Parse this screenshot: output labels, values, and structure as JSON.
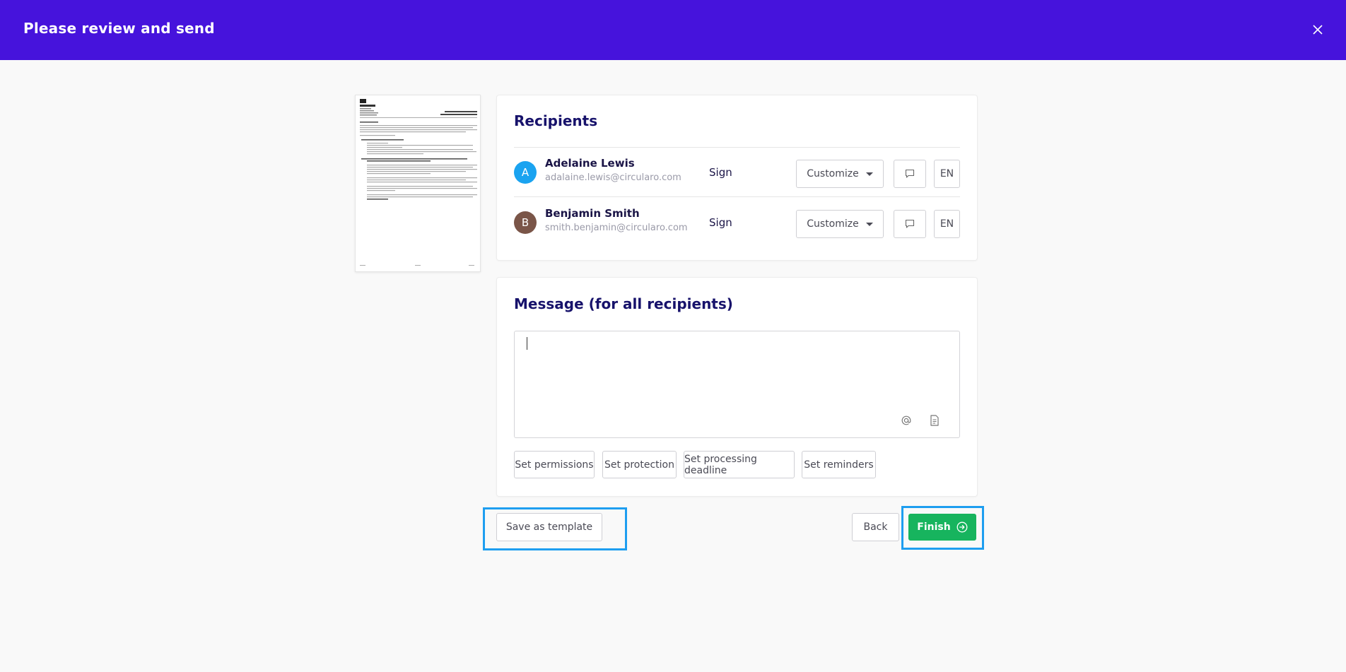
{
  "header": {
    "title": "Please review and send"
  },
  "recipients": {
    "title": "Recipients",
    "items": [
      {
        "initial": "A",
        "name": "Adelaine Lewis",
        "email": "adalaine.lewis@circularo.com",
        "role": "Sign",
        "customize_label": "Customize",
        "lang": "EN",
        "avatar_color": "#1aa3f0"
      },
      {
        "initial": "B",
        "name": "Benjamin Smith",
        "email": "smith.benjamin@circularo.com",
        "role": "Sign",
        "customize_label": "Customize",
        "lang": "EN",
        "avatar_color": "#7a5548"
      }
    ]
  },
  "message": {
    "title": "Message (for all recipients)",
    "value": "",
    "options": [
      "Set permissions",
      "Set protection",
      "Set processing deadline",
      "Set reminders"
    ]
  },
  "footer": {
    "save_template": "Save as template",
    "back": "Back",
    "finish": "Finish"
  },
  "colors": {
    "header": "#4613dc",
    "finish": "#17b45e",
    "highlight": "#1e9ef0",
    "title": "#17126b"
  }
}
